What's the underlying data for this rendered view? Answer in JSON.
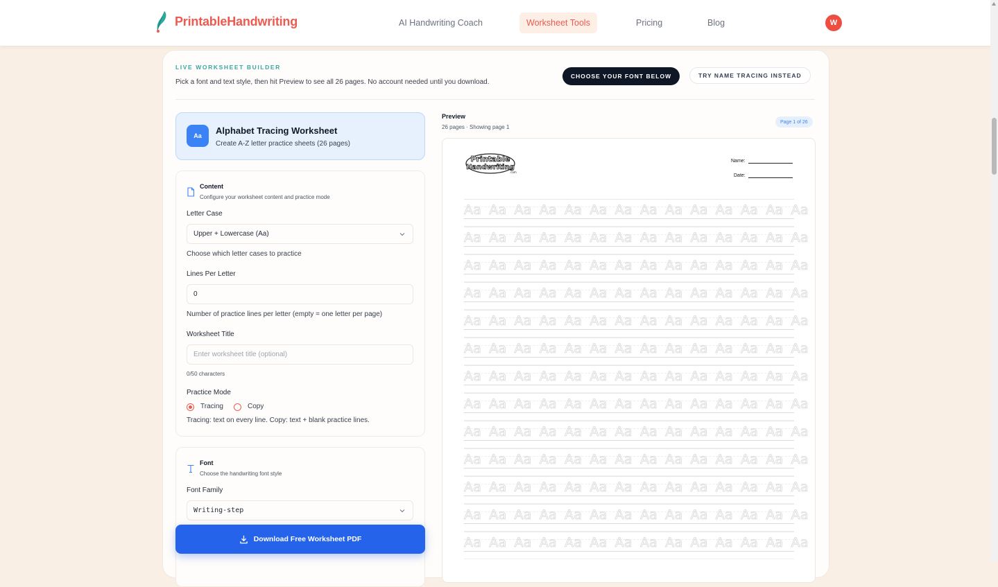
{
  "nav": {
    "brand": "PrintableHandwriting",
    "links": [
      "AI Handwriting Coach",
      "Worksheet Tools",
      "Pricing",
      "Blog"
    ],
    "active_link": "Worksheet Tools",
    "avatar_initial": "W"
  },
  "builder": {
    "kicker": "LIVE WORKSHEET BUILDER",
    "subtitle": "Pick a font and text style, then hit Preview to see all 26 pages. No account needed until you download.",
    "primary_button": "CHOOSE YOUR FONT BELOW",
    "secondary_button": "TRY NAME TRACING INSTEAD"
  },
  "worksheet": {
    "icon_label": "Aa",
    "title": "Alphabet Tracing Worksheet",
    "description": "Create A-Z letter practice sheets (26 pages)"
  },
  "content": {
    "heading": "Content",
    "subheading": "Configure your worksheet content and practice mode",
    "letter_case_label": "Letter Case",
    "letter_case_value": "Upper + Lowercase (Aa)",
    "letter_case_hint": "Choose which letter cases to practice",
    "lines_label": "Lines Per Letter",
    "lines_value": "0",
    "lines_hint": "Number of practice lines per letter (empty = one letter per page)",
    "title_label": "Worksheet Title",
    "title_placeholder": "Enter worksheet title (optional)",
    "title_count": "0/50 characters",
    "mode_label": "Practice Mode",
    "mode_options": [
      "Tracing",
      "Copy"
    ],
    "mode_selected": "Tracing",
    "mode_hint": "Tracing: text on every line. Copy: text + blank practice lines."
  },
  "font": {
    "heading": "Font",
    "subheading": "Choose the handwriting font style",
    "family_label": "Font Family",
    "family_value": "Writing-step"
  },
  "download_label": "Download Free Worksheet PDF",
  "preview": {
    "title": "Preview",
    "subtitle": "26 pages · Showing page 1",
    "page_badge": "Page 1 of 26",
    "sheet_logo_line1": "Printable",
    "sheet_logo_line2": "Handwriting",
    "sheet_logo_small": ".com",
    "name_label": "Name:",
    "date_label": "Date:",
    "row_text": "Aa Aa Aa Aa Aa Aa Aa Aa Aa Aa Aa Aa Aa Aa Aa Aa",
    "row_count": 13
  },
  "colors": {
    "brand": "#ee5a4f",
    "accent_blue": "#2563eb",
    "kicker_teal": "#3aa7a0",
    "page_bg": "#f9efe4",
    "dark_button": "#0f1727"
  }
}
